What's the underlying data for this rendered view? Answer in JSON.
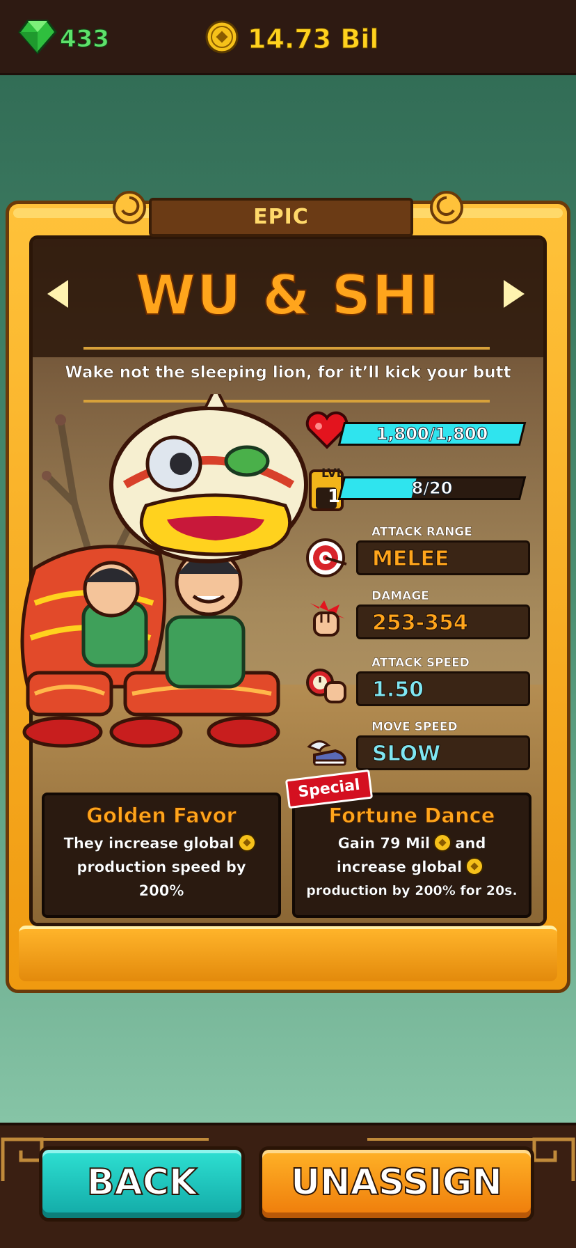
{
  "currency": {
    "gems": "433",
    "coins": "14.73 Bil"
  },
  "hero": {
    "rarity": "EPIC",
    "name": "WU & SHI",
    "tagline": "Wake not the sleeping lion, for it’ll kick your butt"
  },
  "stats": {
    "health": {
      "text": "1,800/1,800",
      "fill": 1.0
    },
    "level": {
      "label": "LVL",
      "value": "1",
      "xp_text": "8/20",
      "fill": 0.4
    },
    "attack_range": {
      "label": "ATTACK RANGE",
      "value": "MELEE"
    },
    "damage": {
      "label": "DAMAGE",
      "value": "253-354"
    },
    "attack_speed": {
      "label": "ATTACK SPEED",
      "value": "1.50"
    },
    "move_speed": {
      "label": "MOVE SPEED",
      "value": "SLOW"
    }
  },
  "abilities": {
    "passive": {
      "title": "Golden Favor",
      "line1": "They increase global",
      "line2": "production speed by",
      "line3": "200%"
    },
    "special": {
      "tag": "Special",
      "title": "Fortune Dance",
      "line1a": "Gain 79 Mil",
      "line1b": "and",
      "line2": "increase global",
      "line3": "production by 200% for 20s."
    }
  },
  "buttons": {
    "back": "BACK",
    "unassign": "UNASSIGN"
  },
  "colors": {
    "accent_orange": "#ffa51c",
    "bar_cyan": "#2fe4ee",
    "gem_green": "#5ee06a",
    "coin_gold": "#ffd21e"
  }
}
